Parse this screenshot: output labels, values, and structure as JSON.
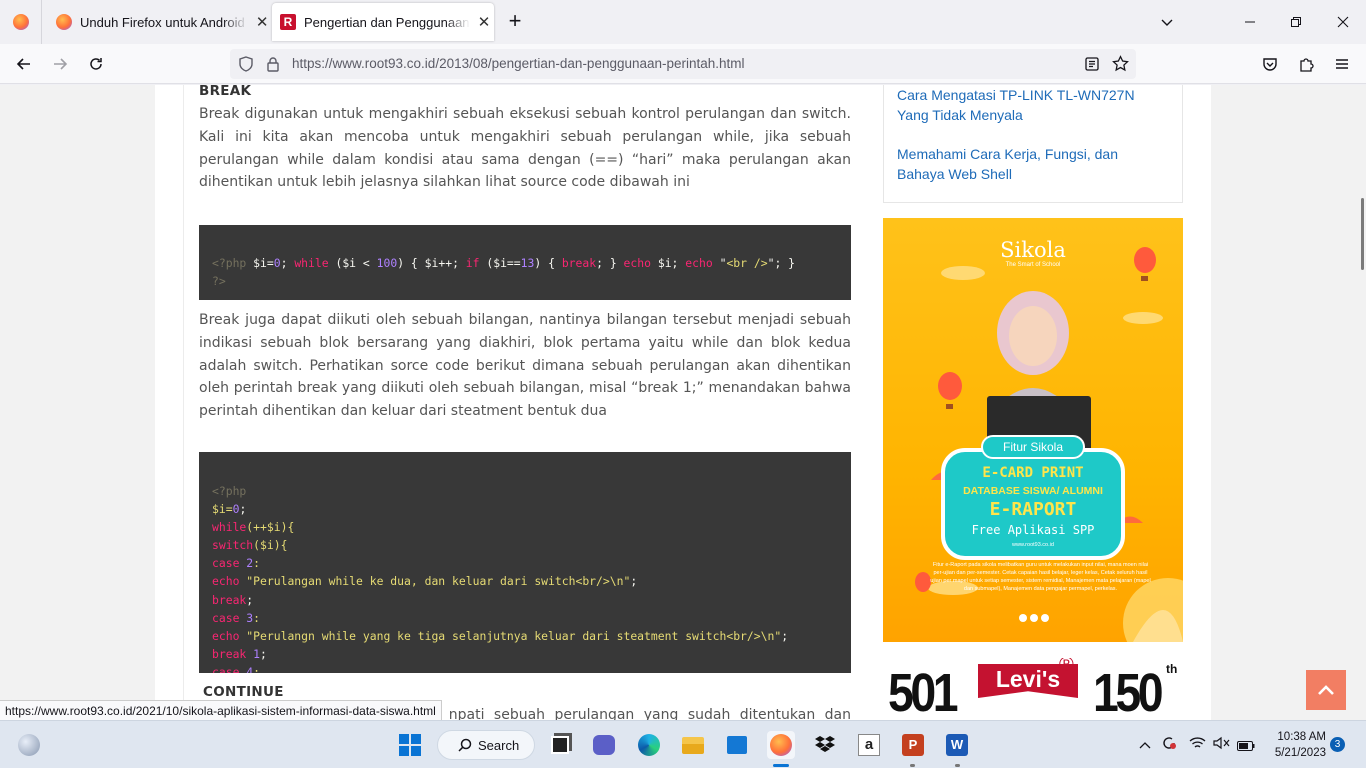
{
  "browser": {
    "tabs": [
      {
        "title": "Unduh Firefox untuk Android d",
        "active": false
      },
      {
        "title": "Pengertian dan Penggunaan Pe",
        "active": true
      }
    ],
    "new_tab_label": "+",
    "url": "https://www.root93.co.id/2013/08/pengertian-dan-penggunaan-perintah.html",
    "status_link": "https://www.root93.co.id/2021/10/sikola-aplikasi-sistem-informasi-data-siswa.html"
  },
  "article": {
    "break_heading": "BREAK",
    "break_para1": "Break digunakan untuk mengakhiri sebuah eksekusi sebuah kontrol perulangan dan switch. Kali ini kita akan mencoba untuk mengakhiri sebuah perulangan while, jika sebuah perulangan while dalam kondisi atau sama dengan (==) “hari” maka perulangan akan dihentikan untuk lebih jelasnya silahkan lihat source code dibawah ini",
    "code1": {
      "line1": {
        "open": "<?php",
        "var1": " $i=",
        "n1": "0",
        "s1": "; ",
        "kw1": "while",
        "s2": " ($i < ",
        "n2": "100",
        "s3": ") { $i++; ",
        "kw2": "if",
        "s4": " ($i==",
        "n3": "13",
        "s5": ") { ",
        "kw3": "break",
        "s6": "; } ",
        "kw4": "echo",
        "s7": " $i; ",
        "kw5": "echo",
        "s8": " \"",
        "str1": "<br />",
        "s9": "\"; }"
      },
      "line2": "?>"
    },
    "break_para2": "Break juga dapat diikuti oleh sebuah bilangan, nantinya bilangan tersebut menjadi sebuah indikasi sebuah blok bersarang yang diakhiri, blok pertama yaitu while dan blok kedua adalah switch. Perhatikan sorce code berikut dimana sebuah perulangan akan dihentikan oleh perintah break yang diikuti oleh sebuah bilangan, misal “break 1;” menandakan bahwa perintah dihentikan dan keluar dari steatment bentuk dua",
    "code2": {
      "l1": "<?php",
      "l2a": "$i=",
      "l2b": "0",
      "l2c": ";",
      "l3a": "while",
      "l3b": "(++$i){",
      "l4a": "switch",
      "l4b": "($i){",
      "l5a": "case",
      "l5b": " 2",
      "l5c": ":",
      "l6a": "echo",
      "l6b": " \"Perulangan while ke dua, dan keluar dari switch<br/>\\n\"",
      "l6c": ";",
      "l7a": "break",
      "l7b": ";",
      "l8a": "case",
      "l8b": " 3",
      "l8c": ":",
      "l9a": "echo",
      "l9b": " \"Perulangn while yang ke tiga selanjutnya keluar dari steatment switch<br/>\\n\"",
      "l9c": ";",
      "l10a": "break",
      "l10b": " 1",
      "l10c": ";",
      "l11a": "case",
      "l11b": " 4",
      "l11c": ":"
    },
    "continue_heading": "CONTINUE",
    "continue_para_visible": "npati sebuah perulangan yang sudah ditentukan dan"
  },
  "sidebar": {
    "related": [
      "Cara Mengatasi TP-LINK TL-WN727N Yang Tidak Menyala",
      "Memahami Cara Kerja, Fungsi, dan Bahaya Web Shell"
    ],
    "ad_sikola": {
      "brand": "Sikola",
      "tagline": "The Smart of School",
      "pill": "Fitur Sikola",
      "line1": "E-CARD PRINT",
      "line2": "DATABASE SISWA/ ALUMNI",
      "line3": "E-RAPORT",
      "line4": "Free Aplikasi SPP",
      "site": "www.root93.co.id",
      "desc": "Fitur e-Raport pada sikola melibatkan guru untuk melakukan input nilai, mana moen nilai per-ujian dan per-semester. Cetak capaian hasil belajar, leger kelas, Cetak seluruh hasil ujian per mapel untuk setiap semester, sistem remidial, Manajemen mata pelajaran (mapel dan submapel), Manajemen data pengajar permapel, perkelas."
    },
    "ad_levis": {
      "left": "501",
      "brand": "Levi's",
      "reg": "®",
      "right": "150",
      "sup": "th"
    }
  },
  "taskbar": {
    "search_label": "Search",
    "time": "10:38 AM",
    "date": "5/21/2023",
    "notification_count": "3"
  }
}
